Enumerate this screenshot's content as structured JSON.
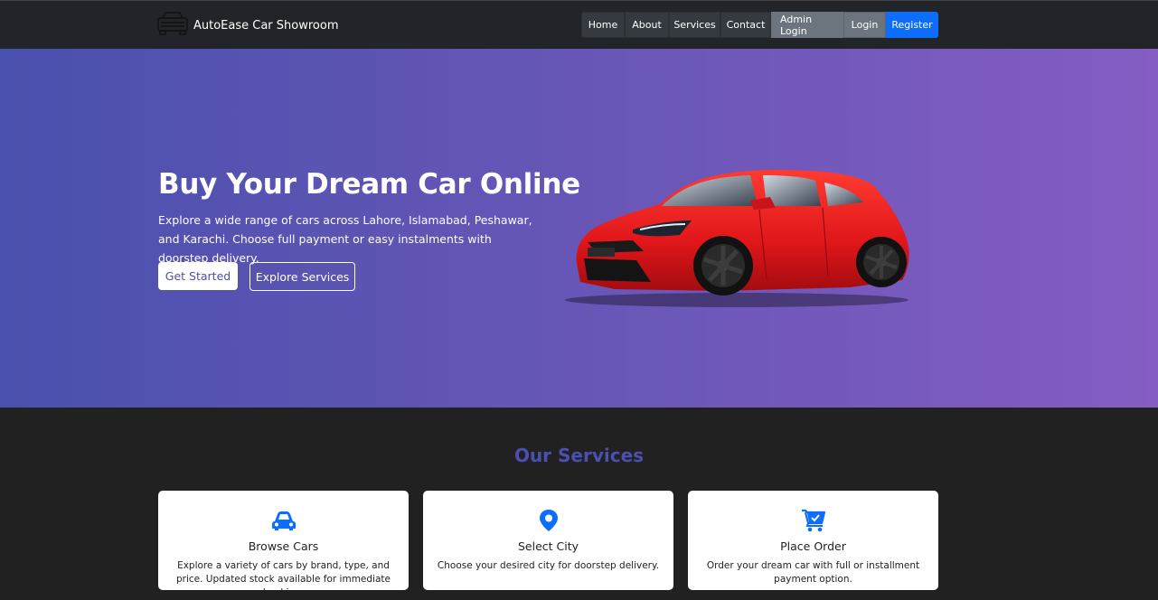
{
  "navbar": {
    "brand": "AutoEase Car Showroom",
    "brand_icon": "car-outline-icon",
    "links": {
      "home": "Home",
      "about": "About",
      "services": "Services",
      "contact": "Contact",
      "admin_login": "Admin Login",
      "login": "Login",
      "register": "Register"
    }
  },
  "hero": {
    "title": "Buy Your Dream Car Online",
    "description": "Explore a wide range of cars across Lahore, Islamabad, Peshawar, and Karachi. Choose full payment or easy instalments with doorstep delivery.",
    "get_started": "Get Started",
    "explore_services": "Explore Services"
  },
  "services": {
    "title": "Our Services",
    "cards": [
      {
        "icon": "car-front-icon",
        "title": "Browse Cars",
        "text": "Explore a variety of cars by brand, type, and price. Updated stock available for immediate booking."
      },
      {
        "icon": "map-pin-icon",
        "title": "Select City",
        "text": "Choose your desired city for doorstep delivery."
      },
      {
        "icon": "cart-check-icon",
        "title": "Place Order",
        "text": "Order your dream car with full or installment payment option."
      }
    ]
  },
  "colors": {
    "navbar_bg": "#212529",
    "hero_gradient_start": "#4a50ad",
    "hero_gradient_end": "#845cc3",
    "register_blue": "#0d6efd",
    "icon_blue": "#0d6efd",
    "section_bg": "#212121",
    "services_title": "#4b4fb0"
  }
}
